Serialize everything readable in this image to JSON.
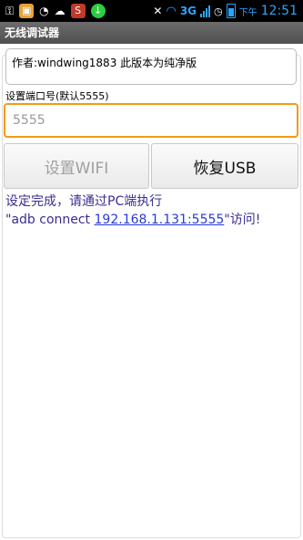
{
  "status_bar": {
    "network": "3G",
    "ampm": "下午",
    "time": "12:51"
  },
  "app": {
    "title": "无线调试器"
  },
  "author_text": "作者:windwing1883 此版本为纯净版",
  "port": {
    "label": "设置端口号(默认5555)",
    "placeholder": "5555",
    "value": ""
  },
  "buttons": {
    "wifi": "设置WIFI",
    "usb": "恢复USB"
  },
  "status": {
    "line1": "设定完成，请通过PC端执行",
    "prefix": "\"adb connect ",
    "link": "192.168.1.131:5555",
    "suffix": "\"访问!"
  }
}
